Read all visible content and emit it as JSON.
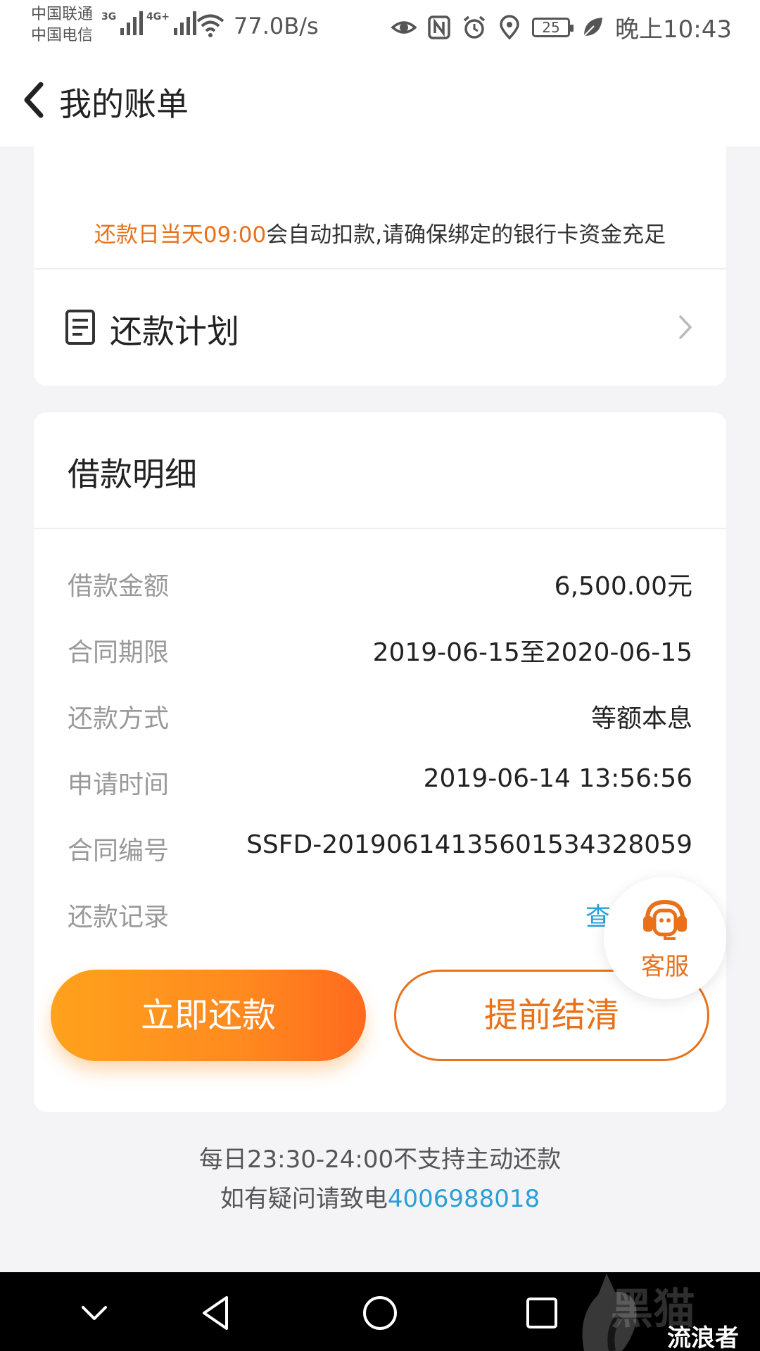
{
  "status_bar": {
    "carrier_1": "中国联通",
    "carrier_2": "中国电信",
    "network_1": "3G",
    "network_2": "4G+",
    "net_speed": "77.0B/s",
    "battery": "25",
    "time": "晚上10:43"
  },
  "header": {
    "title": "我的账单"
  },
  "repay_notice": {
    "highlight": "还款日当天09:00",
    "rest": "会自动扣款,请确保绑定的银行卡资金充足"
  },
  "plan": {
    "label": "还款计划"
  },
  "loan_detail": {
    "title": "借款明细",
    "rows": [
      {
        "key": "借款金额",
        "value": "6,500.00元"
      },
      {
        "key": "合同期限",
        "value": "2019-06-15至2020-06-15"
      },
      {
        "key": "还款方式",
        "value": "等额本息"
      },
      {
        "key": "申请时间",
        "value": "2019-06-14 13:56:56"
      },
      {
        "key": "合同编号",
        "value": "SSFD-20190614135601534328059"
      },
      {
        "key": "还款记录",
        "value": "查"
      }
    ]
  },
  "buttons": {
    "repay_now": "立即还款",
    "settle_early": "提前结清"
  },
  "customer_service": {
    "label": "客服"
  },
  "footer": {
    "line1": "每日23:30-24:00不支持主动还款",
    "line2_prefix": "如有疑问请致电",
    "phone": "4006988018"
  },
  "watermark": {
    "text": "流浪者",
    "brand": "黑猫"
  },
  "colors": {
    "accent_orange": "#e8711a",
    "link_blue": "#2a9fd6",
    "button_gradient_start": "#ffa21c",
    "button_gradient_end": "#ff6a1e"
  }
}
